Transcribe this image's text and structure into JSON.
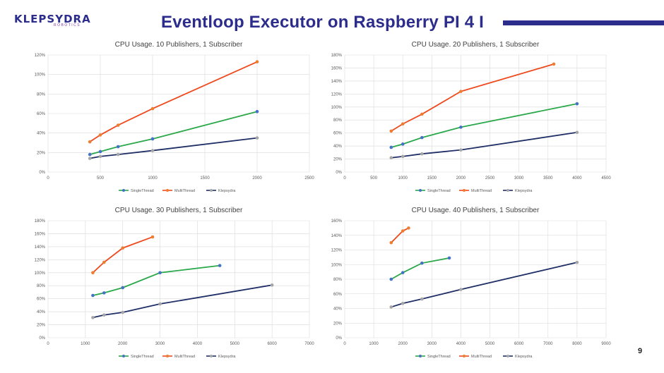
{
  "header": {
    "logo_text": "KLEPSYDRA",
    "logo_subtext": "ROBOTICS",
    "title": "Eventloop Executor on Raspberry PI 4 I",
    "page_number": "9"
  },
  "colors": {
    "title": "#2b2c8c",
    "single_thread": "#2aa84a",
    "multi_thread": "#ee4a1e",
    "klepsydra": "#1f2f66",
    "marker_single": "#4472c4",
    "marker_multi": "#ed7d31",
    "marker_klepsydra": "#a5a5a5"
  },
  "chart_data": [
    {
      "type": "line",
      "title": "CPU Usage. 10 Publishers, 1 Subscriber",
      "xlim": [
        0,
        2500
      ],
      "xticks": [
        0,
        500,
        1000,
        1500,
        2000,
        2500
      ],
      "ylim": [
        0,
        120
      ],
      "yticks": [
        0,
        20,
        40,
        60,
        80,
        100,
        120
      ],
      "y_unit": "%",
      "legend_position": "bottom",
      "series": [
        {
          "name": "SingleThread",
          "color_key": "single_thread",
          "marker_key": "marker_single",
          "x": [
            400,
            500,
            670,
            1000,
            2000
          ],
          "y": [
            18,
            21,
            26,
            34,
            62
          ]
        },
        {
          "name": "MultiThread",
          "color_key": "multi_thread",
          "marker_key": "marker_multi",
          "x": [
            400,
            500,
            670,
            1000,
            2000
          ],
          "y": [
            31,
            38,
            48,
            65,
            113
          ]
        },
        {
          "name": "Klepsydra",
          "color_key": "klepsydra",
          "marker_key": "marker_klepsydra",
          "x": [
            400,
            500,
            670,
            1000,
            2000
          ],
          "y": [
            14,
            16,
            18,
            22,
            35
          ]
        }
      ]
    },
    {
      "type": "line",
      "title": "CPU Usage. 20 Publishers, 1 Subscriber",
      "xlim": [
        0,
        4500
      ],
      "xticks": [
        0,
        500,
        1000,
        1500,
        2000,
        2500,
        3000,
        3500,
        4000,
        4500
      ],
      "ylim": [
        0,
        180
      ],
      "yticks": [
        0,
        20,
        40,
        60,
        80,
        100,
        120,
        140,
        160,
        180
      ],
      "y_unit": "%",
      "legend_position": "bottom",
      "series": [
        {
          "name": "SingleThread",
          "color_key": "single_thread",
          "marker_key": "marker_single",
          "x": [
            800,
            1000,
            1330,
            2000,
            4000
          ],
          "y": [
            38,
            43,
            53,
            69,
            105
          ]
        },
        {
          "name": "MultiThread",
          "color_key": "multi_thread",
          "marker_key": "marker_multi",
          "x": [
            800,
            1000,
            1330,
            2000,
            3600
          ],
          "y": [
            63,
            74,
            89,
            124,
            166
          ]
        },
        {
          "name": "Klepsydra",
          "color_key": "klepsydra",
          "marker_key": "marker_klepsydra",
          "x": [
            800,
            1000,
            1330,
            2000,
            4000
          ],
          "y": [
            22,
            24,
            28,
            34,
            61
          ]
        }
      ]
    },
    {
      "type": "line",
      "title": "CPU Usage. 30 Publishers, 1 Subscriber",
      "xlim": [
        0,
        7000
      ],
      "xticks": [
        0,
        1000,
        2000,
        3000,
        4000,
        5000,
        6000,
        7000
      ],
      "ylim": [
        0,
        180
      ],
      "yticks": [
        0,
        20,
        40,
        60,
        80,
        100,
        120,
        140,
        160,
        180
      ],
      "y_unit": "%",
      "legend_position": "bottom",
      "series": [
        {
          "name": "SingleThread",
          "color_key": "single_thread",
          "marker_key": "marker_single",
          "x": [
            1200,
            1500,
            2000,
            3000,
            4600
          ],
          "y": [
            65,
            69,
            77,
            100,
            111
          ]
        },
        {
          "name": "MultiThread",
          "color_key": "multi_thread",
          "marker_key": "marker_multi",
          "x": [
            1200,
            1500,
            2000,
            2800
          ],
          "y": [
            100,
            116,
            138,
            155
          ]
        },
        {
          "name": "Klepsydra",
          "color_key": "klepsydra",
          "marker_key": "marker_klepsydra",
          "x": [
            1200,
            1500,
            2000,
            3000,
            6000
          ],
          "y": [
            31,
            35,
            39,
            52,
            81
          ]
        }
      ]
    },
    {
      "type": "line",
      "title": "CPU Usage. 40 Publishers, 1 Subscriber",
      "xlim": [
        0,
        9000
      ],
      "xticks": [
        0,
        1000,
        2000,
        3000,
        4000,
        5000,
        6000,
        7000,
        8000,
        9000
      ],
      "ylim": [
        0,
        160
      ],
      "yticks": [
        0,
        20,
        40,
        60,
        80,
        100,
        120,
        140,
        160
      ],
      "y_unit": "%",
      "legend_position": "bottom",
      "series": [
        {
          "name": "SingleThread",
          "color_key": "single_thread",
          "marker_key": "marker_single",
          "x": [
            1600,
            2000,
            2660,
            3600
          ],
          "y": [
            80,
            89,
            102,
            109
          ]
        },
        {
          "name": "MultiThread",
          "color_key": "multi_thread",
          "marker_key": "marker_multi",
          "x": [
            1600,
            2000,
            2200
          ],
          "y": [
            130,
            146,
            150
          ]
        },
        {
          "name": "Klepsydra",
          "color_key": "klepsydra",
          "marker_key": "marker_klepsydra",
          "x": [
            1600,
            2000,
            2660,
            4000,
            8000
          ],
          "y": [
            42,
            47,
            53,
            66,
            103
          ]
        }
      ]
    }
  ]
}
